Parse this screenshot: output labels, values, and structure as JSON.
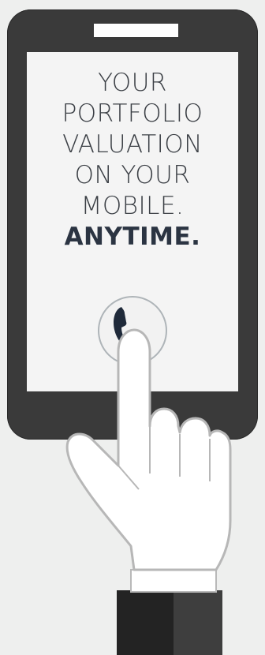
{
  "headline": {
    "lines": [
      "YOUR",
      "PORTFOLIO",
      "VALUATION",
      "ON YOUR",
      "MOBILE."
    ],
    "emphasis": "ANYTIME."
  },
  "icons": {
    "call": "phone-handset-icon",
    "hand": "pointing-hand-icon"
  },
  "colors": {
    "background": "#eeefee",
    "phone_body": "#3a3a3a",
    "screen": "#f4f4f4",
    "text": "#3b3f45",
    "emphasis_text": "#2b3442",
    "sleeve_dark": "#232323",
    "sleeve_light": "#3e3e3e"
  }
}
